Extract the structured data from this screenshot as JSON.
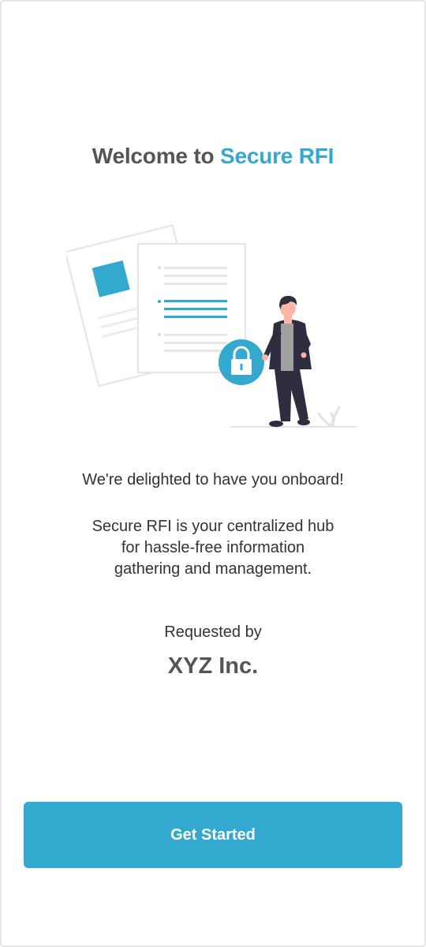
{
  "header": {
    "title_prefix": "Welcome to ",
    "title_brand": "Secure RFI"
  },
  "intro": {
    "lead": "We're delighted to have you onboard!",
    "description_lines": [
      "Secure RFI is your centralized hub",
      "for hassle-free information",
      "gathering and management."
    ]
  },
  "requester": {
    "label": "Requested by",
    "company": "XYZ Inc."
  },
  "actions": {
    "get_started_label": "Get Started"
  },
  "colors": {
    "accent": "#33a9cf",
    "heading": "#555559",
    "body_text": "#333333"
  },
  "icons": [
    "documents-illustration",
    "lock-icon",
    "person-illustration"
  ]
}
